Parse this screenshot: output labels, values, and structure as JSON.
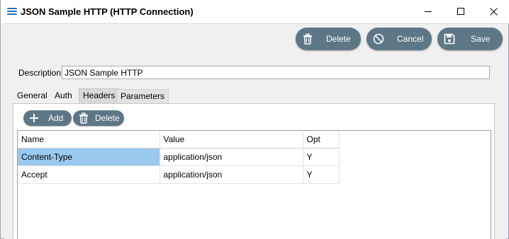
{
  "window": {
    "title": "JSON Sample HTTP (HTTP Connection)",
    "controls": [
      "minimize",
      "maximize",
      "close"
    ]
  },
  "toolbar": {
    "delete_label": "Delete",
    "cancel_label": "Cancel",
    "save_label": "Save"
  },
  "description": {
    "label": "Description",
    "value": "JSON Sample HTTP"
  },
  "tabs": [
    {
      "label": "General"
    },
    {
      "label": "Auth"
    },
    {
      "label": "Headers",
      "active": true
    },
    {
      "label": "Parameters"
    }
  ],
  "headers_panel": {
    "add_label": "Add",
    "delete_label": "Delete",
    "columns": [
      "Name",
      "Value",
      "Opt"
    ],
    "rows": [
      {
        "name": "Content-Type",
        "value": "application/json",
        "opt": "Y",
        "selected": true
      },
      {
        "name": "Accept",
        "value": "application/json",
        "opt": "Y"
      }
    ]
  },
  "colors": {
    "button_bg": "#5d7786",
    "selection": "#99c9ef",
    "app_icon": "#1f6fb5"
  },
  "icons": [
    "list-icon",
    "minimize-icon",
    "maximize-icon",
    "close-icon",
    "trash-icon",
    "cancel-icon",
    "save-icon",
    "plus-icon"
  ]
}
